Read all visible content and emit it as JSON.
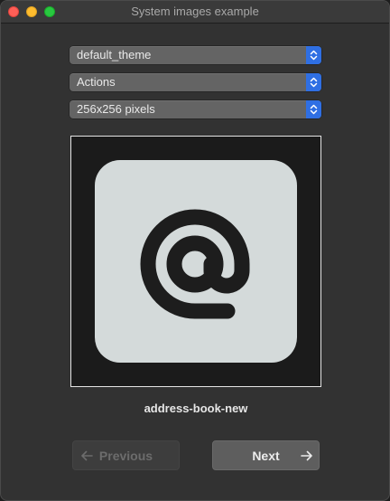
{
  "window": {
    "title": "System images example"
  },
  "controls": {
    "theme": "default_theme",
    "context": "Actions",
    "size": "256x256 pixels"
  },
  "preview": {
    "icon": "address-book-new",
    "icon_glyph": "at-sign-icon",
    "tile_color": "#d4dada",
    "glyph_color": "#1d1d1d"
  },
  "navigation": {
    "previous_label": "Previous",
    "next_label": "Next",
    "previous_enabled": false
  },
  "colors": {
    "accent": "#2f6fe3",
    "window_bg": "#323232"
  }
}
